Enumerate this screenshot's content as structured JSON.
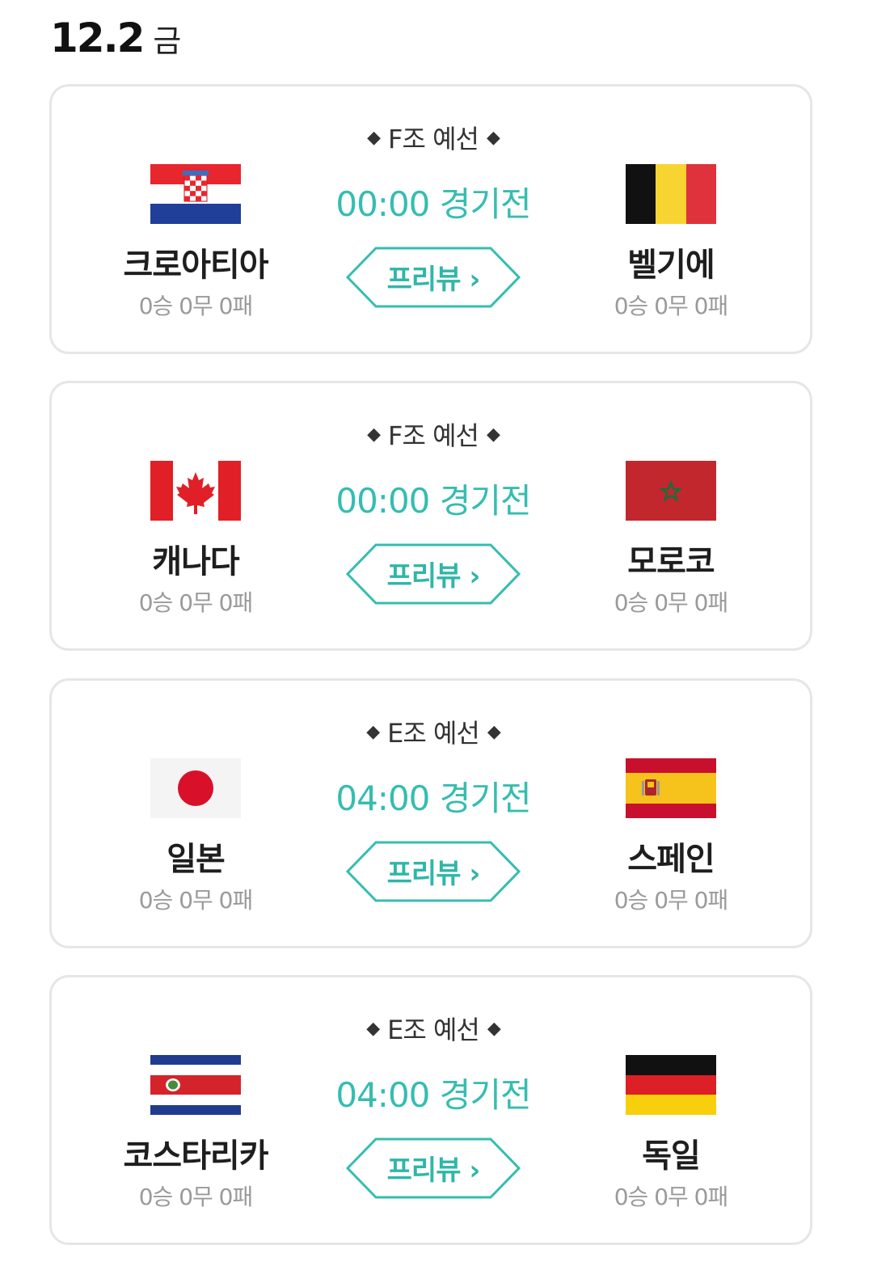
{
  "header": {
    "date": "12.2",
    "weekday": "금"
  },
  "matches": [
    {
      "group": "F조 예선",
      "time": "00:00 경기전",
      "preview_label": "프리뷰",
      "home": {
        "name": "크로아티아",
        "record": "0승 0무 0패",
        "flag": "croatia-flag"
      },
      "away": {
        "name": "벨기에",
        "record": "0승 0무 0패",
        "flag": "belgium-flag"
      }
    },
    {
      "group": "F조 예선",
      "time": "00:00 경기전",
      "preview_label": "프리뷰",
      "home": {
        "name": "캐나다",
        "record": "0승 0무 0패",
        "flag": "canada-flag"
      },
      "away": {
        "name": "모로코",
        "record": "0승 0무 0패",
        "flag": "morocco-flag"
      }
    },
    {
      "group": "E조 예선",
      "time": "04:00 경기전",
      "preview_label": "프리뷰",
      "home": {
        "name": "일본",
        "record": "0승 0무 0패",
        "flag": "japan-flag"
      },
      "away": {
        "name": "스페인",
        "record": "0승 0무 0패",
        "flag": "spain-flag"
      }
    },
    {
      "group": "E조 예선",
      "time": "04:00 경기전",
      "preview_label": "프리뷰",
      "home": {
        "name": "코스타리카",
        "record": "0승 0무 0패",
        "flag": "costa-rica-flag"
      },
      "away": {
        "name": "독일",
        "record": "0승 0무 0패",
        "flag": "germany-flag"
      }
    }
  ],
  "colors": {
    "accent": "#35bdb0",
    "card_border": "#e6e6e6",
    "record_gray": "#9a9a9a"
  }
}
